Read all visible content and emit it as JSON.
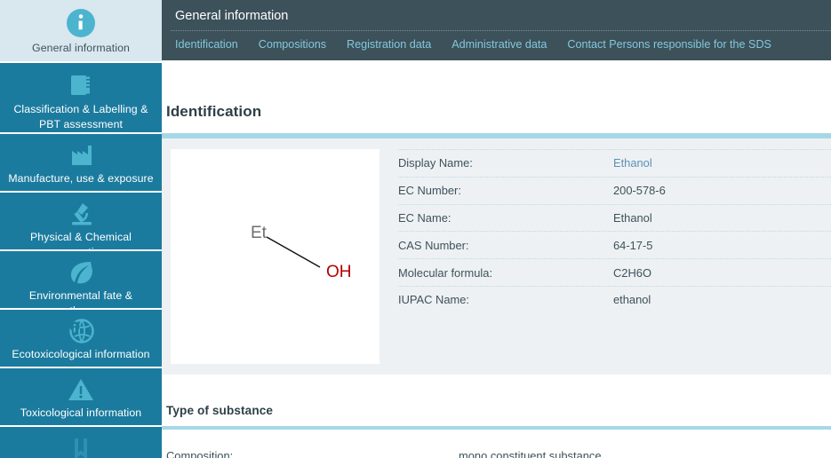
{
  "sidebar": {
    "items": [
      {
        "label": "General information",
        "icon": "info-circle-icon",
        "active": true
      },
      {
        "label": "Classification & Labelling & PBT assessment",
        "icon": "books-icon",
        "active": false
      },
      {
        "label": "Manufacture, use & exposure",
        "icon": "factory-icon",
        "active": false
      },
      {
        "label": "Physical & Chemical properties",
        "icon": "microscope-icon",
        "active": false
      },
      {
        "label": "Environmental fate & pathways",
        "icon": "leaf-icon",
        "active": false
      },
      {
        "label": "Ecotoxicological information",
        "icon": "globe-info-icon",
        "active": false
      },
      {
        "label": "Toxicological information",
        "icon": "warning-triangle-icon",
        "active": false
      },
      {
        "label": "",
        "icon": "bookmark-icon",
        "active": false
      }
    ]
  },
  "header": {
    "title": "General information",
    "tabs": [
      {
        "label": "Identification"
      },
      {
        "label": "Compositions"
      },
      {
        "label": "Registration data"
      },
      {
        "label": "Administrative data"
      },
      {
        "label": "Contact Persons responsible for the SDS"
      }
    ]
  },
  "identification": {
    "title": "Identification",
    "structure": {
      "left_label": "Et",
      "right_label": "OH"
    },
    "rows": [
      {
        "key": "Display Name:",
        "value": "Ethanol",
        "is_link": true
      },
      {
        "key": "EC Number:",
        "value": "200-578-6",
        "is_link": false
      },
      {
        "key": "EC Name:",
        "value": "Ethanol",
        "is_link": false
      },
      {
        "key": "CAS Number:",
        "value": "64-17-5",
        "is_link": false
      },
      {
        "key": "Molecular formula:",
        "value": "C2H6O",
        "is_link": false
      },
      {
        "key": "IUPAC Name:",
        "value": "ethanol",
        "is_link": false
      }
    ]
  },
  "type_of_substance": {
    "title": "Type of substance",
    "composition_key": "Composition:",
    "composition_value": "mono constituent substance"
  },
  "colors": {
    "sidebar_bg": "#1b7b9e",
    "sidebar_active_bg": "#d9e7ef",
    "header_bg": "#3c515a",
    "tab_text": "#84c8dd",
    "accent_rule": "#a5d8e6",
    "panel_bg": "#eef1f3",
    "link": "#5a91b8",
    "molecule_oh": "#b10000",
    "molecule_et": "#6e6e6e"
  }
}
